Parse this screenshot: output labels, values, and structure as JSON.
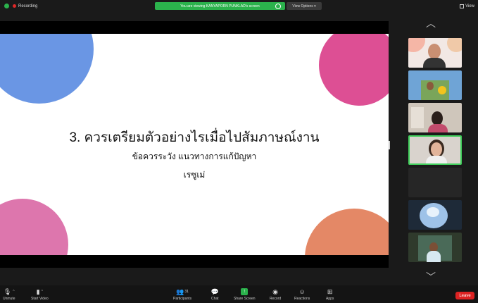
{
  "topbar": {
    "recording_label": "Recording",
    "viewing_banner": "You are viewing KANYAPORN PUNKLAD's screen",
    "view_options_label": "View Options ▾",
    "view_label": "View"
  },
  "slide": {
    "title": "3. ควรเตรียมตัวอย่างไรเมื่อไปสัมภาษณ์งาน",
    "subtitle": "ข้อควรระวัง แนวทางการแก้ปัญหา",
    "line3": "เรซูเม่",
    "colors": {
      "blue": "#6a96e4",
      "pink": "#dd4f94",
      "light_pink": "#dd76ad",
      "orange": "#e48866"
    }
  },
  "gallery": {
    "up_icon": "chevron-up-icon",
    "down_icon": "chevron-down-icon",
    "active_border": "#3fce5a"
  },
  "toolbar": {
    "unmute": "Unmute",
    "start_video": "Start Video",
    "participants": "Participants",
    "participant_count": "31",
    "chat": "Chat",
    "share_screen": "Share Screen",
    "record": "Record",
    "reactions": "Reactions",
    "apps": "Apps",
    "leave": "Leave",
    "leave_color": "#dd2222",
    "share_color": "#2bb24c"
  }
}
